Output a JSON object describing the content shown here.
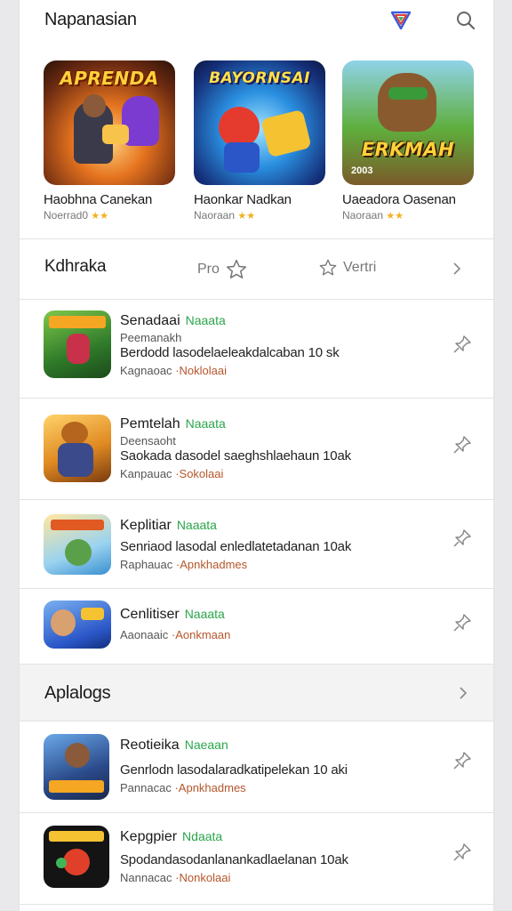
{
  "header": {
    "title": "Napanasian",
    "logo_icon": "shield-logo-icon",
    "search_icon": "search-icon"
  },
  "featured": [
    {
      "art": "APRENDA",
      "name": "Haobhna Canekan",
      "meta": "Noerrad0",
      "stars": "★★"
    },
    {
      "art": "BAYORNSAI",
      "name": "Haonkar Nadkan",
      "meta": "Naoraan",
      "stars": "★★"
    },
    {
      "art": "ERKMAH",
      "name": "Uaeadora Oasenan",
      "meta": "Naoraan",
      "stars": "★★"
    }
  ],
  "featured_art_sub": "2003",
  "filter": {
    "title": "Kdhraka",
    "pro_label": "Pro",
    "vert_label": "Vertri"
  },
  "list1": [
    {
      "name": "Senadaai",
      "tag": "Naaata",
      "sub": "Peemanakh",
      "desc": "Berdodd lasodelaeleakdalcaban 10 sk",
      "foot_pre": "Kagnaoac",
      "foot_dev": "Noklolaai"
    },
    {
      "name": "Pemtelah",
      "tag": "Naaata",
      "sub": "Deensaoht",
      "desc": "Saokada dasodel saeghshlaehaun 10ak",
      "foot_pre": "Kanpauac",
      "foot_dev": "Sokolaai"
    },
    {
      "name": "Keplitiar",
      "tag": "Naaata",
      "sub": "",
      "desc": "Senriaod lasodal enledlatetadanan 10ak",
      "foot_pre": "Raphauac",
      "foot_dev": "Apnkhadmes"
    },
    {
      "name": "Cenlitiser",
      "tag": "Naaata",
      "sub": "",
      "desc": "",
      "foot_pre": "Aaonaaic",
      "foot_dev": "Aonkmaan"
    }
  ],
  "section2": {
    "title": "Aplalogs"
  },
  "list2": [
    {
      "name": "Reotieika",
      "tag": "Naeaan",
      "sub": "",
      "desc": "Genrlodn lasodalaradkatipelekan 10 aki",
      "foot_pre": "Pannacac",
      "foot_dev": "Apnkhadmes"
    },
    {
      "name": "Kepgpier",
      "tag": "Ndaata",
      "sub": "",
      "desc": "Spodandasodanlanankadlaelanan 10ak",
      "foot_pre": "Nannacac",
      "foot_dev": "Nonkolaai"
    }
  ],
  "colors": {
    "accent_green": "#2aa54a",
    "dev_orange": "#b5562b",
    "star_gold": "#f2b01e",
    "background": "#e9e9eb"
  }
}
